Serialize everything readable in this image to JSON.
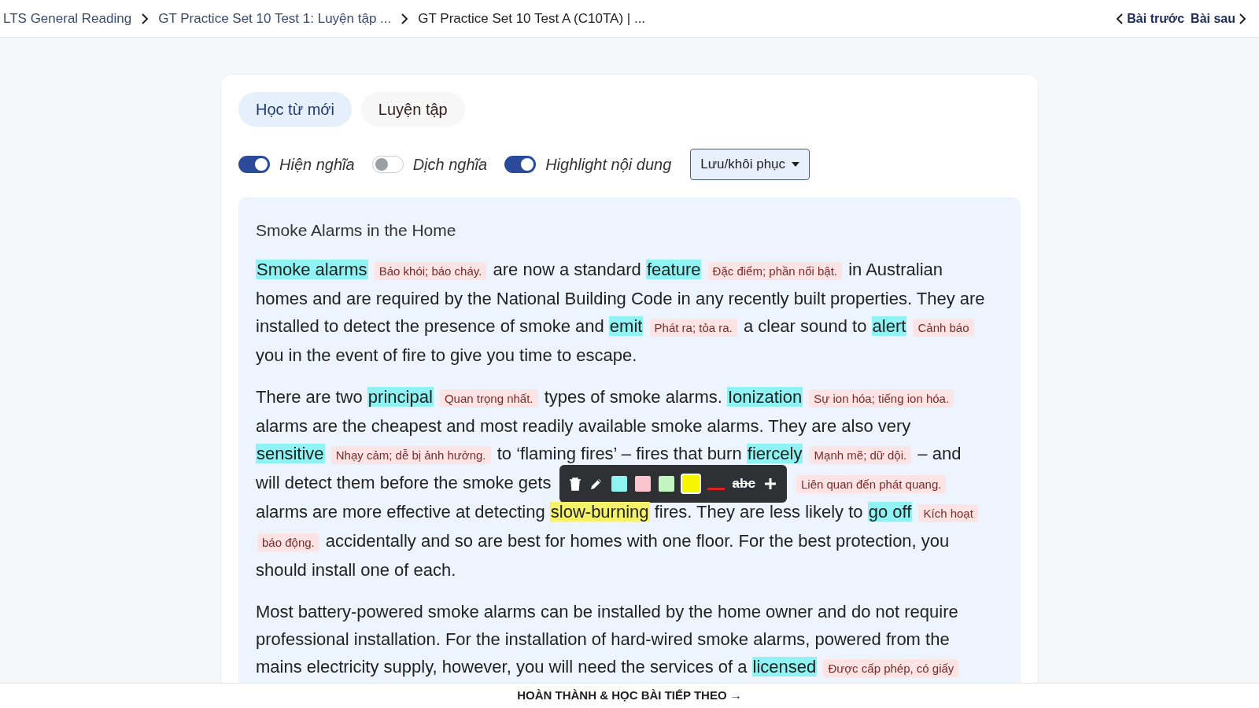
{
  "breadcrumb": [
    "LTS General Reading",
    "GT Practice Set 10 Test 1: Luyện tập ...",
    "GT Practice Set 10 Test A (C10TA) | ..."
  ],
  "nav": {
    "prev": "Bài trước",
    "next": "Bài sau"
  },
  "tabs": [
    {
      "label": "Học từ mới",
      "selected": true
    },
    {
      "label": "Luyện tập",
      "selected": false
    }
  ],
  "toggles": [
    {
      "label": "Hiện nghĩa",
      "on": true
    },
    {
      "label": "Dịch nghĩa",
      "on": false
    },
    {
      "label": "Highlight nội dung",
      "on": true
    }
  ],
  "save_menu": {
    "label": "Lưu/khôi phục"
  },
  "passage": {
    "title": "Smoke Alarms in the Home",
    "paragraphs": [
      [
        {
          "kind": "term",
          "text": "Smoke alarms",
          "color": "#8ff3f3"
        },
        {
          "kind": "gloss",
          "text": "Báo khói; báo cháy."
        },
        {
          "kind": "text",
          "text": "are now a standard"
        },
        {
          "kind": "term",
          "text": "feature",
          "color": "#8ff3f3"
        },
        {
          "kind": "gloss",
          "text": "Đặc điểm; phần nổi bật."
        },
        {
          "kind": "text",
          "text": "in Australian"
        },
        {
          "kind": "text",
          "text": "homes and are required by the National Building Code in any recently built properties. They are"
        },
        {
          "kind": "text",
          "text": "installed to detect the presence of smoke and"
        },
        {
          "kind": "term",
          "text": "emit",
          "color": "#8ff3f3"
        },
        {
          "kind": "gloss",
          "text": "Phát ra; tỏa ra."
        },
        {
          "kind": "text",
          "text": "a clear sound to"
        },
        {
          "kind": "term",
          "text": "alert",
          "color": "#8ff3f3"
        },
        {
          "kind": "gloss",
          "text": "Cảnh báo"
        },
        {
          "kind": "text",
          "text": "you in the event of fire to give you time to escape."
        }
      ],
      [
        {
          "kind": "text",
          "text": "There are two"
        },
        {
          "kind": "term",
          "text": "principal",
          "color": "#8ff3f3"
        },
        {
          "kind": "gloss",
          "text": "Quan trọng nhất."
        },
        {
          "kind": "text",
          "text": "types of smoke alarms."
        },
        {
          "kind": "term",
          "text": "Ionization",
          "color": "#8ff3f3"
        },
        {
          "kind": "gloss",
          "text": "Sự ion hóa; tiếng ion hóa."
        },
        {
          "kind": "text",
          "text": "alarms are the cheapest and most readily available smoke alarms. They are also very"
        },
        {
          "kind": "term",
          "text": "sensitive",
          "color": "#8ff3f3"
        },
        {
          "kind": "gloss",
          "text": "Nhạy cảm; dễ bị ảnh hưởng."
        },
        {
          "kind": "text",
          "text": "to ‘flaming fires’ – fires that burn"
        },
        {
          "kind": "term",
          "text": "fiercely",
          "color": "#8ff3f3"
        },
        {
          "kind": "gloss",
          "text": "Mạnh mẽ; dữ dội."
        },
        {
          "kind": "text",
          "text": "– and"
        },
        {
          "kind": "text",
          "text": "will detect them before the smoke gets"
        },
        {
          "kind": "toolbar"
        },
        {
          "kind": "gloss",
          "text": "Liên quan đến phát quang."
        },
        {
          "kind": "text",
          "text": "alarms are more effective at detecting"
        },
        {
          "kind": "term",
          "text": "slow-burning",
          "color": "#f5f26a"
        },
        {
          "kind": "text",
          "text": "fires. They are less likely to"
        },
        {
          "kind": "term",
          "text": "go off",
          "color": "#8ff3f3"
        },
        {
          "kind": "gloss",
          "text": "Kích hoạt"
        },
        {
          "kind": "gloss",
          "text": "báo động."
        },
        {
          "kind": "text",
          "text": "accidentally and so are best for homes with one floor. For the best protection, you"
        },
        {
          "kind": "text",
          "text": "should install one of each."
        }
      ],
      [
        {
          "kind": "text",
          "text": "Most battery-powered smoke alarms can be installed by the home owner and do not require"
        },
        {
          "kind": "text",
          "text": "professional installation. For the installation of hard-wired smoke alarms, powered from the"
        },
        {
          "kind": "text",
          "text": "mains electricity supply, however, you will need the services of a"
        },
        {
          "kind": "term",
          "text": "licensed",
          "color": "#8ff3f3"
        },
        {
          "kind": "gloss",
          "text": "Được cấp phép, có giấy"
        }
      ]
    ]
  },
  "highlight_toolbar": {
    "swatches": [
      {
        "color": "#8ff3f3",
        "selected": false
      },
      {
        "color": "#f9c6cf",
        "selected": false
      },
      {
        "color": "#c2f5c0",
        "selected": false
      },
      {
        "color": "#f8f500",
        "selected": true
      }
    ],
    "strike_label": "abc"
  },
  "footer": {
    "label": "HOÀN THÀNH & HỌC BÀI TIẾP THEO →"
  }
}
